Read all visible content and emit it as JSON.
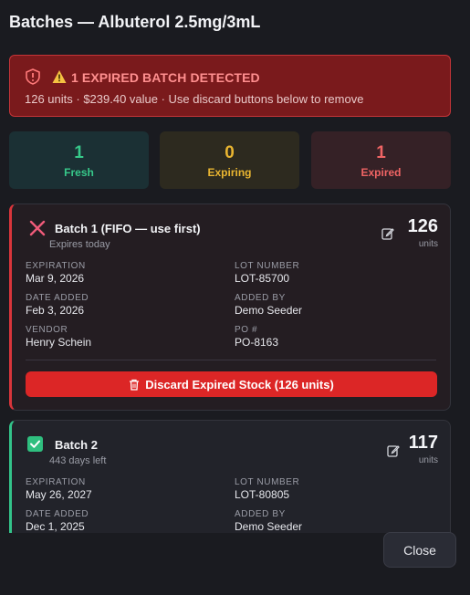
{
  "dialog": {
    "title": "Batches — Albuterol 2.5mg/3mL",
    "close_label": "Close"
  },
  "alert": {
    "heading": "1 EXPIRED BATCH DETECTED",
    "detail": "126 units · $239.40 value · Use discard buttons below to remove"
  },
  "stats": {
    "fresh": {
      "count": "1",
      "label": "Fresh"
    },
    "expiring": {
      "count": "0",
      "label": "Expiring"
    },
    "expired": {
      "count": "1",
      "label": "Expired"
    }
  },
  "batches": [
    {
      "name": "Batch 1 (FIFO — use first)",
      "subtitle": "Expires today",
      "quantity": "126",
      "unit": "units",
      "status": "expired",
      "fields": {
        "expiration_label": "EXPIRATION",
        "expiration": "Mar 9, 2026",
        "lot_label": "LOT NUMBER",
        "lot": "LOT-85700",
        "date_added_label": "DATE ADDED",
        "date_added": "Feb 3, 2026",
        "added_by_label": "ADDED BY",
        "added_by": "Demo Seeder",
        "vendor_label": "VENDOR",
        "vendor": "Henry Schein",
        "po_label": "PO #",
        "po": "PO-8163"
      },
      "discard_label": "Discard Expired Stock (126 units)"
    },
    {
      "name": "Batch 2",
      "subtitle": "443 days left",
      "quantity": "117",
      "unit": "units",
      "status": "fresh",
      "fields": {
        "expiration_label": "EXPIRATION",
        "expiration": "May 26, 2027",
        "lot_label": "LOT NUMBER",
        "lot": "LOT-80805",
        "date_added_label": "DATE ADDED",
        "date_added": "Dec 1, 2025",
        "added_by_label": "ADDED BY",
        "added_by": "Demo Seeder"
      }
    }
  ],
  "colors": {
    "background": "#1a1b20",
    "alert_bg": "#7a1a1c",
    "alert_border": "#c53438",
    "fresh": "#37c98a",
    "expiring": "#e9b531",
    "expired": "#ef6464",
    "discard_button": "#dc2626"
  },
  "icons": {
    "alert": "shield-alert-icon",
    "warning": "warning-triangle-icon",
    "expired_status": "x-icon",
    "fresh_status": "check-square-icon",
    "edit": "edit-icon",
    "discard": "trash-icon"
  }
}
